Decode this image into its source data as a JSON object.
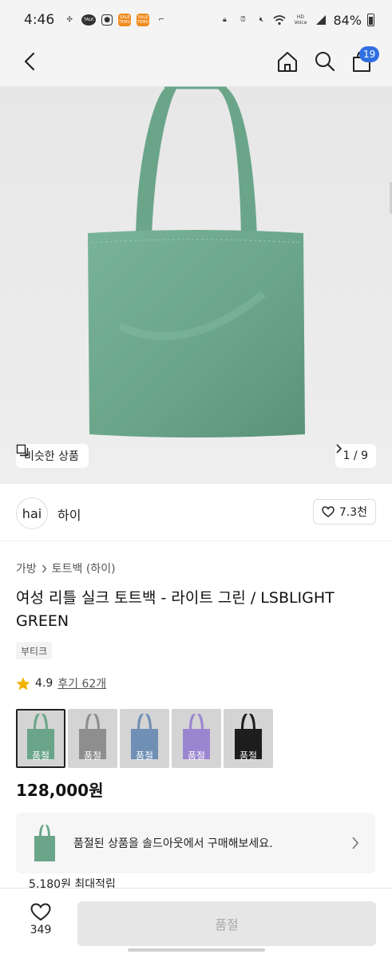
{
  "status_bar": {
    "time": "4:46",
    "battery": "84%",
    "talk_badge": "TALK",
    "app_badge_1": "SALE TEMU",
    "app_badge_2": "SALE TEMU",
    "hd_voice": "HD Voice"
  },
  "nav": {
    "cart_count": "19"
  },
  "hero": {
    "similar_label": "비슷한 상품",
    "pager": "1 / 9"
  },
  "brand": {
    "logo_text": "hai",
    "name": "하이",
    "like_count": "7.3천"
  },
  "product": {
    "breadcrumb": [
      "가방",
      "토트백 (하이)"
    ],
    "title": "여성 리틀 실크 토트백 - 라이트 그린 / LSBLIGHT GREEN",
    "tag": "부티크",
    "rating": "4.9",
    "reviews": "후기 62개",
    "variants": [
      {
        "label": "품절",
        "color": "#6aa58a",
        "selected": true
      },
      {
        "label": "품절",
        "color": "#8e8e8e",
        "selected": false
      },
      {
        "label": "품절",
        "color": "#6f8fb5",
        "selected": false
      },
      {
        "label": "품절",
        "color": "#9a86d0",
        "selected": false
      },
      {
        "label": "품절",
        "color": "#1d1d1d",
        "selected": false
      }
    ],
    "price": "128,000원"
  },
  "soldout_banner": {
    "text": "품절된 상품을 솔드아웃에서 구매해보세요."
  },
  "points": "5,180원 최대적립",
  "bottom": {
    "wish_count": "349",
    "buy_label": "품절"
  },
  "colors": {
    "accent": "#2f6fe0",
    "bag": "#6aa58a",
    "star": "#f2b300"
  }
}
